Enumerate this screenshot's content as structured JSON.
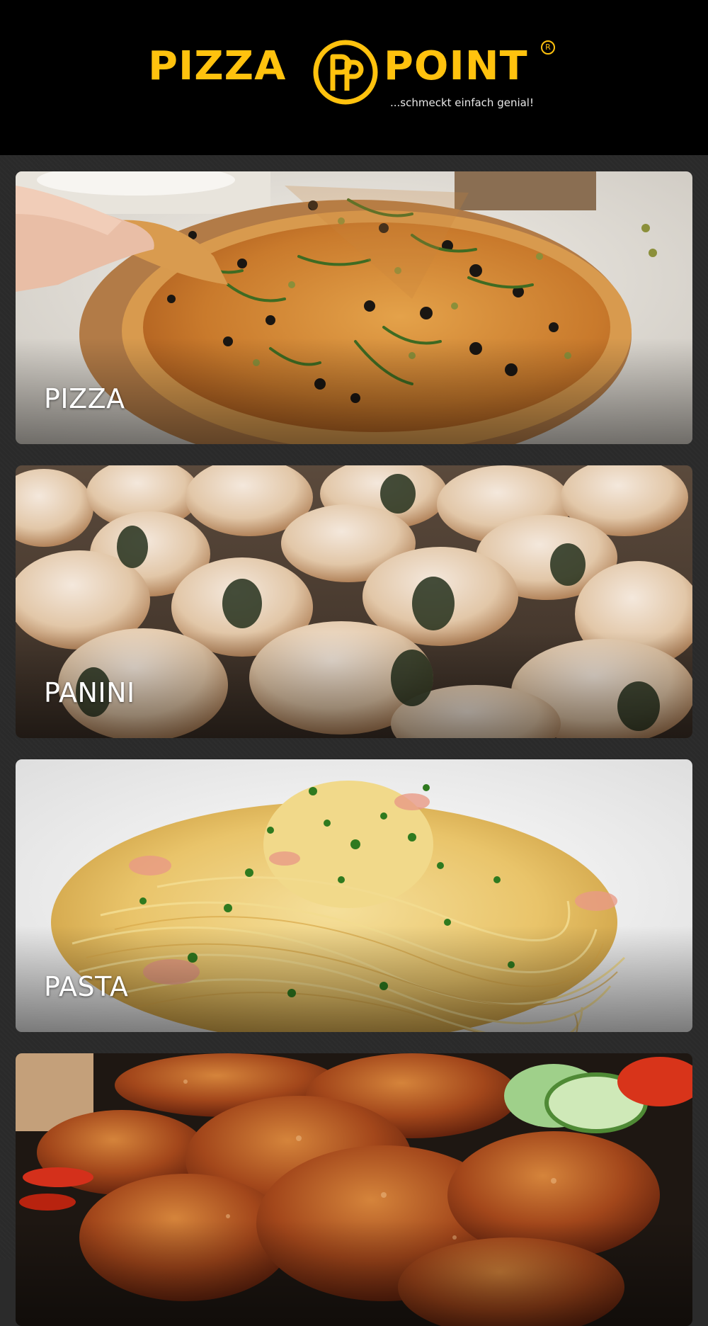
{
  "brand": {
    "name_left": "PIZZA",
    "name_right": "POINT",
    "monogram": "PP",
    "registered": "R",
    "tagline": "...schmeckt einfach genial!",
    "accent_color": "#ffc20e"
  },
  "categories": [
    {
      "label": "PIZZA"
    },
    {
      "label": "PANINI"
    },
    {
      "label": "PASTA"
    },
    {
      "label": ""
    }
  ]
}
